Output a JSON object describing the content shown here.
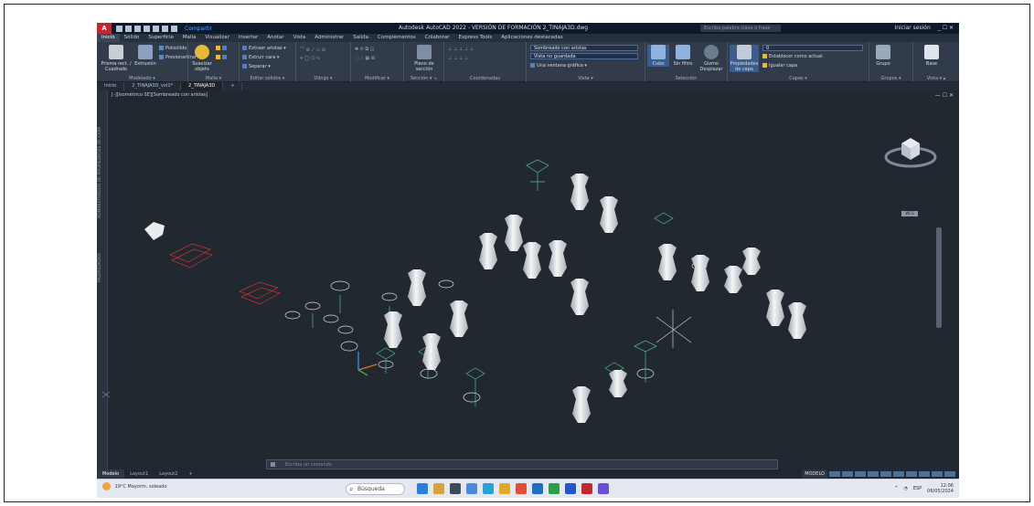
{
  "titlebar": {
    "logo": "A",
    "share": "Compartir",
    "title": "Autodesk AutoCAD 2022 - VERSIÓN DE FORMACIÓN  2_TINAJA3D.dwg",
    "search_placeholder": "Escriba palabra clave o frase",
    "signin": "Iniciar sesión",
    "window_controls": "_ ☐ ✕"
  },
  "ribbon_tabs": [
    "Inicio",
    "Sólido",
    "Superficie",
    "Malla",
    "Visualizar",
    "Insertar",
    "Anotar",
    "Vista",
    "Administrar",
    "Salida",
    "Complementos",
    "Colaborar",
    "Express Tools",
    "Aplicaciones destacadas"
  ],
  "ribbon": {
    "modeling": {
      "label": "Modelado ▾",
      "btn1": "Prisma rect. / Cuadrado",
      "btn2": "Extrusión",
      "sm1": "Polisólido",
      "sm2": "Presionartirar"
    },
    "mesh": {
      "label": "Malla ▾",
      "btn": "Suavizar objeto"
    },
    "solid_edit": {
      "label": "Editar sólidos ▾",
      "sm1": "Extraer aristas ▾",
      "sm2": "Extruir cara ▾",
      "sm3": "Separar ▾"
    },
    "draw": {
      "label": "Dibujo ▾"
    },
    "modify": {
      "label": "Modificar ▾"
    },
    "section": {
      "label": "Sección ▾ ↘",
      "btn": "Plano de sección"
    },
    "coords": {
      "label": "Coordenadas"
    },
    "view": {
      "label": "Vista ▾",
      "drop1": "Sombreado con aristas",
      "drop2": "Vista no guardada",
      "drop3": "Una ventana gráfica ▾"
    },
    "select": {
      "label": "Selección",
      "btn1": "Cubo",
      "btn2": "Sin filtro",
      "btn3": "Gizmo Desplazar"
    },
    "layers": {
      "label": "Capas ▾",
      "btn": "Propiedades de capa",
      "drop": "0",
      "sm1": "Establecer como actual",
      "sm2": "Igualar capa"
    },
    "groups": {
      "label": "Grupos ▾",
      "btn": "Grupo"
    },
    "viewpanel": {
      "label": "Vista ▾ ▴",
      "btn": "Base"
    }
  },
  "file_tabs": [
    "Inicio",
    "2_TINAJA3D_vol1*",
    "2_TINAJA3D"
  ],
  "viewport": {
    "label": "[-][Isométrico SE][Sombreado con aristas]",
    "controls": "— ☐ ✕",
    "palette_text": "ADMINISTRADOR DE PROPIEDADES DE CAPA",
    "palette_text2": "PROPIEDADES",
    "viewcube_label": "WCS",
    "command_placeholder": "Escriba un comando"
  },
  "layout_tabs": [
    "Modelo",
    "Layout1",
    "Layout2",
    "+"
  ],
  "status": {
    "model": "MODELO"
  },
  "taskbar": {
    "weather_temp": "19°C",
    "weather_text": "Mayorm. soleado",
    "search": "Búsqueda",
    "lang": "ESP",
    "time": "12:06",
    "date": "06/05/2024"
  },
  "colors": {
    "viewport_bg": "#212830",
    "ribbon_bg": "#313b49",
    "accent": "#4d6a9a",
    "autocad_red": "#c4262e"
  }
}
